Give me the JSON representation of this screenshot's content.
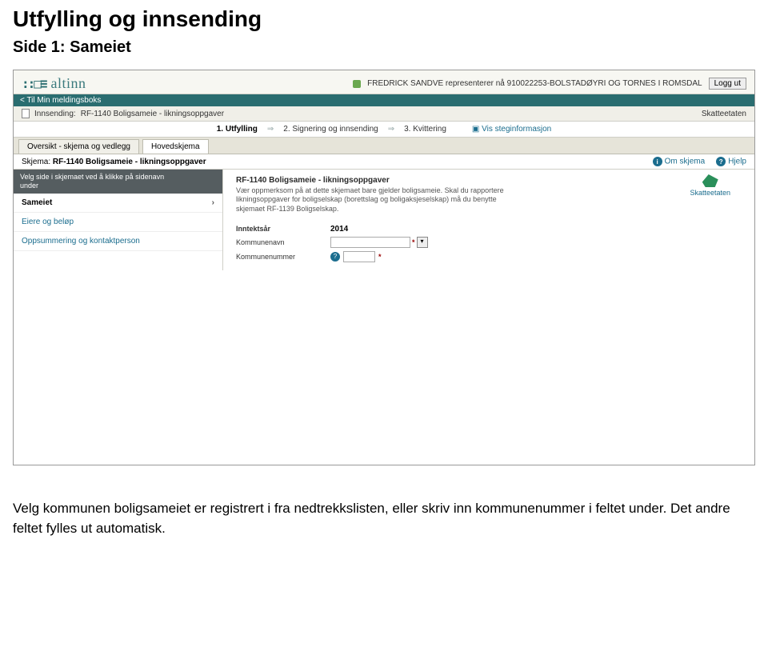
{
  "doc": {
    "title": "Utfylling og innsending",
    "subtitle": "Side 1: Sameiet",
    "paragraph": "Velg kommunen boligsameiet er registrert i fra nedtrekkslisten, eller skriv inn kommunenummer i feltet under. Det andre feltet fylles ut automatisk."
  },
  "app": {
    "logo_text": "altinn",
    "user_line": "FREDRICK SANDVE representerer nå 910022253-BOLSTADØYRI OG TORNES I ROMSDAL",
    "logout": "Logg ut",
    "back_link": "< Til Min meldingsboks",
    "sending_label": "Innsending:",
    "sending_title": "RF-1140 Boligsameie - likningsoppgaver",
    "agency_right": "Skatteetaten",
    "steps": {
      "s1": "1. Utfylling",
      "s2": "2. Signering og innsending",
      "s3": "3. Kvittering",
      "info_link": "Vis steginformasjon"
    },
    "tabs": {
      "overview": "Oversikt - skjema og vedlegg",
      "main": "Hovedskjema"
    },
    "schema_label": "Skjema:",
    "schema_title": "RF-1140 Boligsameie - likningsoppgaver",
    "about_link": "Om skjema",
    "help_link": "Hjelp",
    "sidebar": {
      "head_line1": "Velg side i skjemaet ved å klikke på sidenavn",
      "head_line2": "under",
      "items": {
        "0": {
          "label": "Sameiet"
        },
        "1": {
          "label": "Eiere og beløp"
        },
        "2": {
          "label": "Oppsummering og kontaktperson"
        }
      }
    },
    "form": {
      "title": "RF-1140 Boligsameie - likningsoppgaver",
      "note": "Vær oppmerksom på at dette skjemaet bare gjelder boligsameie. Skal du rapportere likningsoppgaver for boligselskap (borettslag og boligaksjeselskap) må du benytte skjemaet RF-1139 Boligselskap.",
      "agency_name": "Skatteetaten",
      "year_label": "Inntektsår",
      "year_value": "2014",
      "komm_name_label": "Kommunenavn",
      "komm_name_value": "",
      "komm_num_label": "Kommunenummer",
      "komm_num_value": ""
    }
  }
}
